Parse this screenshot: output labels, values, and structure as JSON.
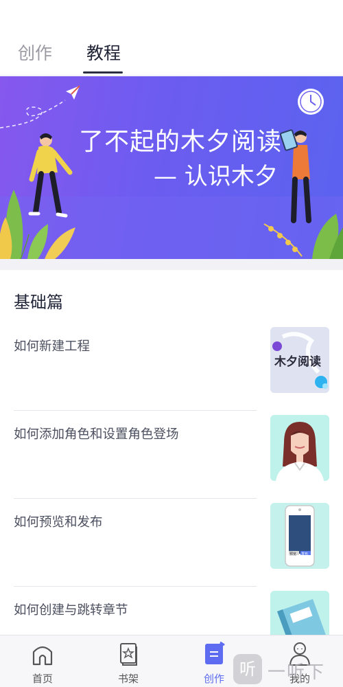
{
  "tabs": [
    {
      "label": "创作",
      "active": false
    },
    {
      "label": "教程",
      "active": true
    }
  ],
  "banner": {
    "title": "了不起的木夕阅读",
    "subtitle": "— 认识木夕"
  },
  "section": {
    "title": "基础篇"
  },
  "tutorials": [
    {
      "title": "如何新建工程",
      "thumb_icon": "muxi-logo-icon",
      "thumb_text": "木夕阅读"
    },
    {
      "title": "如何添加角色和设置角色登场",
      "thumb_icon": "character-portrait-icon"
    },
    {
      "title": "如何预览和发布",
      "thumb_icon": "phone-preview-icon",
      "thumb_buttons": [
        "预览",
        "发布"
      ]
    },
    {
      "title": "如何创建与跳转章节",
      "thumb_icon": "notebook-icon"
    }
  ],
  "bottom_nav": [
    {
      "label": "首页",
      "icon": "home-icon",
      "active": false
    },
    {
      "label": "书架",
      "icon": "bookshelf-icon",
      "active": false
    },
    {
      "label": "创作",
      "icon": "create-icon",
      "active": true
    },
    {
      "label": "我的",
      "icon": "profile-icon",
      "active": false
    }
  ],
  "watermark": {
    "badge": "听",
    "text": "一听下载"
  },
  "colors": {
    "accent": "#5d6cf0",
    "banner_start": "#8658ee",
    "banner_end": "#5a63ef",
    "text_dark": "#222639"
  }
}
